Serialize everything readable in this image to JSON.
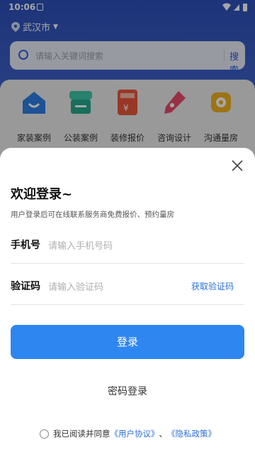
{
  "status": {
    "time": "10:06"
  },
  "location": {
    "city": "武汉市"
  },
  "search": {
    "placeholder": "请输入关键词搜索",
    "button": "搜索"
  },
  "categories": [
    {
      "label": "家装案例",
      "icon": "house-icon",
      "color": "#2f7fe8"
    },
    {
      "label": "公装案例",
      "icon": "shop-icon",
      "color": "#22a98c"
    },
    {
      "label": "装修报价",
      "icon": "calculator-icon",
      "color": "#e8553b"
    },
    {
      "label": "咨询设计",
      "icon": "pen-icon",
      "color": "#e84a6a"
    },
    {
      "label": "沟通量房",
      "icon": "tape-measure-icon",
      "color": "#f0b21e"
    }
  ],
  "login": {
    "title": "欢迎登录~",
    "subtitle": "用户登录后可在线联系服务商免费报价、预约量房",
    "phone_label": "手机号",
    "phone_placeholder": "请输入手机号码",
    "code_label": "验证码",
    "code_placeholder": "请输入验证码",
    "get_code": "获取验证码",
    "submit": "登录",
    "password_login": "密码登录",
    "agree_prefix": "我已阅读并同意",
    "user_agreement": "《用户协议》",
    "separator": "、",
    "privacy_policy": "《隐私政策》"
  },
  "colors": {
    "primary": "#2e86f0",
    "header": "#2f56c9"
  }
}
